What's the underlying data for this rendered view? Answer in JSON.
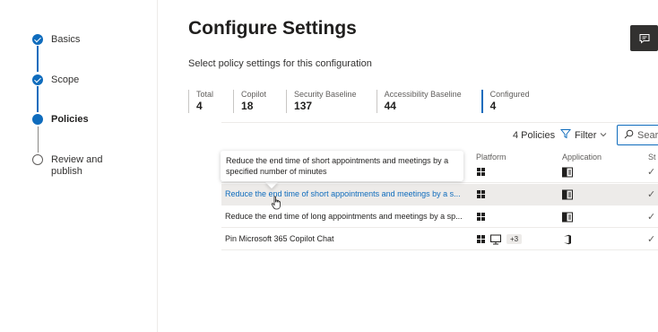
{
  "stepper": {
    "steps": [
      {
        "label": "Basics",
        "state": "done"
      },
      {
        "label": "Scope",
        "state": "done"
      },
      {
        "label": "Policies",
        "state": "current"
      },
      {
        "label": "Review and publish",
        "state": "pending"
      }
    ]
  },
  "page": {
    "title": "Configure Settings",
    "subtitle": "Select policy settings for this configuration"
  },
  "stats": [
    {
      "label": "Total",
      "value": "4"
    },
    {
      "label": "Copilot",
      "value": "18"
    },
    {
      "label": "Security Baseline",
      "value": "137"
    },
    {
      "label": "Accessibility Baseline",
      "value": "44"
    },
    {
      "label": "Configured",
      "value": "4"
    }
  ],
  "toolbar": {
    "count": "4 Policies",
    "filter_label": "Filter",
    "search_placeholder": "Sear"
  },
  "table": {
    "columns": [
      "Platform",
      "Application",
      "St"
    ],
    "rows": [
      {
        "name": "",
        "platforms": [
          "windows-icon"
        ],
        "application": "access-icon",
        "status": "✓"
      },
      {
        "name": "Reduce the end time of short appointments and meetings by a s...",
        "platforms": [
          "windows-icon"
        ],
        "application": "access-icon",
        "status": "✓"
      },
      {
        "name": "Reduce the end time of long appointments and meetings by a sp...",
        "platforms": [
          "windows-icon"
        ],
        "application": "access-icon",
        "status": "✓"
      },
      {
        "name": "Pin Microsoft 365 Copilot Chat",
        "platforms": [
          "windows-icon",
          "monitor-icon"
        ],
        "platform_more": "+3",
        "application": "office-icon",
        "status": "✓"
      }
    ]
  },
  "tooltip": {
    "text": "Reduce the end time of short appointments and meetings by a specified number of minutes"
  },
  "colors": {
    "accent": "#0f6cbd",
    "selected_row": "#edebe9",
    "feedback_button": "#323130"
  }
}
